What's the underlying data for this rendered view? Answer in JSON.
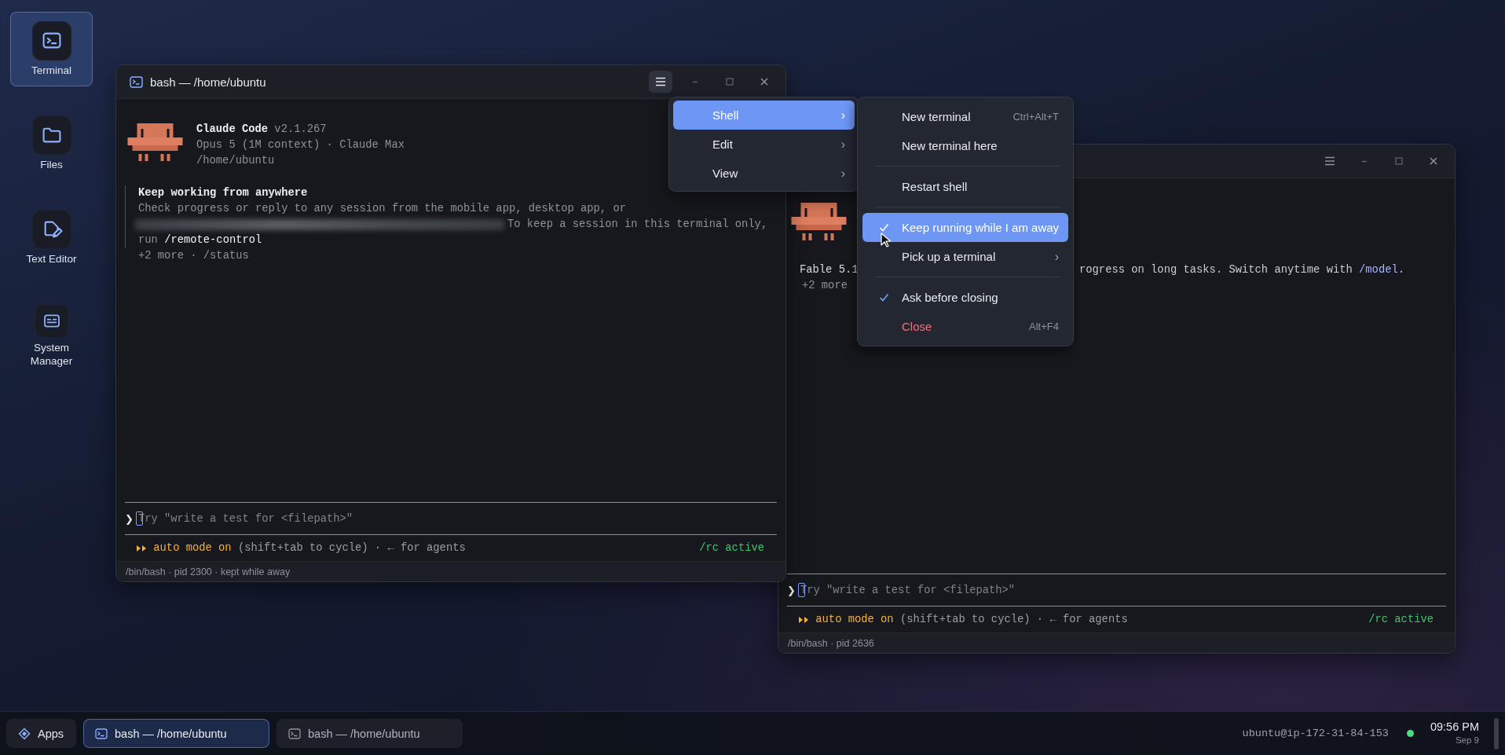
{
  "desktop_icons": [
    {
      "label": "Terminal",
      "kind": "terminal",
      "selected": true
    },
    {
      "label": "Files",
      "kind": "folder",
      "selected": false
    },
    {
      "label": "Text Editor",
      "kind": "editor",
      "selected": false
    },
    {
      "label": "System Manager",
      "kind": "system",
      "selected": false
    }
  ],
  "windows": [
    {
      "title": "bash — /home/ubuntu",
      "menu_open": true,
      "header": {
        "name": "Claude Code",
        "version": "v2.1.267",
        "lines": [
          "Opus 5 (1M context) · Claude Max",
          "/home/ubuntu"
        ]
      },
      "lines": [
        {
          "kind": "notice_title",
          "text": "Keep working from anywhere"
        },
        {
          "kind": "notice",
          "text": "Check progress or reply to any session from the mobile app, desktop app, or"
        },
        {
          "kind": "notice_redacted",
          "text": "To keep a session in this terminal only,"
        },
        {
          "kind": "notice_rich",
          "text": "run **/remote-control**"
        },
        {
          "kind": "plain",
          "text": "+2 more · /status"
        }
      ],
      "prompt_symbol": "❯",
      "placeholder": "Try \"write a test for <filepath>\"",
      "mode": "auto mode on",
      "hint": "(shift+tab to cycle) · ← for agents",
      "remote": "/rc active",
      "footer": "/bin/bash · pid 2300 · kept while away"
    },
    {
      "menu_open": false,
      "lines": [
        {
          "kind": "split",
          "left": "Fable 5.1",
          "right": "rogress on long tasks. Switch anytime with ",
          "command": "/model",
          "after": "."
        },
        {
          "kind": "plain",
          "text": "+2 more"
        }
      ],
      "prompt_symbol": "❯",
      "placeholder": "Try \"write a test for <filepath>\"",
      "mode": "auto mode on",
      "hint": "(shift+tab to cycle) · ← for agents",
      "remote": "/rc active",
      "footer": "/bin/bash · pid 2636"
    }
  ],
  "menu": {
    "items": [
      {
        "label": "Shell",
        "selected": true,
        "arrow": "›"
      },
      {
        "label": "Edit",
        "selected": false,
        "arrow": "›"
      },
      {
        "label": "View",
        "selected": false,
        "arrow": "›"
      }
    ]
  },
  "submenu": {
    "items": [
      {
        "kind": "item",
        "label": "New terminal",
        "shortcut": "Ctrl+Alt+T",
        "selected": false,
        "checked": false,
        "danger": false
      },
      {
        "kind": "item",
        "label": "New terminal here",
        "selected": false,
        "checked": false,
        "danger": false
      },
      {
        "kind": "separator"
      },
      {
        "kind": "item",
        "label": "Restart shell",
        "selected": false,
        "checked": false,
        "danger": false
      },
      {
        "kind": "separator"
      },
      {
        "kind": "item",
        "label": "Keep running while I am away",
        "selected": true,
        "checked": true,
        "danger": false
      },
      {
        "kind": "item",
        "label": "Pick up a terminal",
        "arrow": "›",
        "selected": false,
        "checked": false,
        "danger": false
      },
      {
        "kind": "separator"
      },
      {
        "kind": "item",
        "label": "Ask before closing",
        "selected": false,
        "checked": true,
        "danger": false
      },
      {
        "kind": "item",
        "label": "Close",
        "shortcut": "Alt+F4",
        "selected": false,
        "checked": false,
        "danger": true
      }
    ]
  },
  "taskbar": {
    "apps_label": "Apps",
    "tasks": [
      {
        "label": "bash — /home/ubuntu",
        "selected": true
      },
      {
        "label": "bash — /home/ubuntu",
        "selected": false
      }
    ],
    "user": "ubuntu@ip-172-31-84-153",
    "time": "09:56 PM",
    "date": "Sep 9"
  }
}
